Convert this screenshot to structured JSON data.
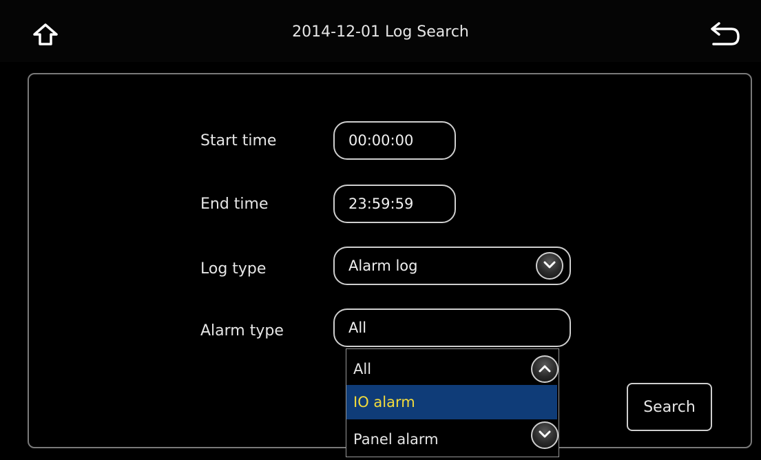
{
  "header": {
    "title": "2014-12-01  Log Search",
    "home_icon": "home-icon",
    "back_icon": "back-arrow-icon"
  },
  "form": {
    "start_time": {
      "label": "Start time",
      "value": "00:00:00"
    },
    "end_time": {
      "label": "End time",
      "value": "23:59:59"
    },
    "log_type": {
      "label": "Log type",
      "value": "Alarm log"
    },
    "alarm_type": {
      "label": "Alarm type",
      "value": "All"
    }
  },
  "alarm_type_dropdown": {
    "options": [
      "All",
      "IO alarm",
      "Panel alarm"
    ],
    "selected": "IO alarm"
  },
  "search_button": {
    "label": "Search"
  },
  "colors": {
    "background": "#000000",
    "border": "#cfcfcf",
    "selected_bg": "#0f3c78",
    "selected_text": "#f3dc3c"
  }
}
